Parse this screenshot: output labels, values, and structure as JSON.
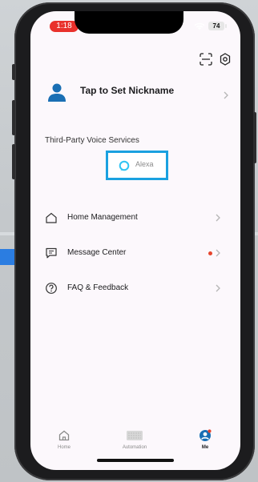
{
  "status_bar": {
    "time": "1:18",
    "battery": "74"
  },
  "profile": {
    "nickname_prompt": "Tap to Set Nickname"
  },
  "voice_services": {
    "title": "Third-Party Voice Services",
    "alexa_label": "Alexa"
  },
  "menu": [
    {
      "label": "Home Management",
      "icon": "house-icon"
    },
    {
      "label": "Message Center",
      "icon": "message-icon",
      "unread": true
    },
    {
      "label": "FAQ & Feedback",
      "icon": "question-icon"
    }
  ],
  "tabs": [
    {
      "label": "Home",
      "icon": "home-tab-icon"
    },
    {
      "label": "Automation",
      "icon": "automation-tab-icon"
    },
    {
      "label": "Me",
      "icon": "me-tab-icon",
      "active": true,
      "badge": true
    }
  ],
  "colors": {
    "accent_blue": "#1a6fb4",
    "highlight_border": "#1aa1e0",
    "alexa_cyan": "#31c4f3",
    "unread_dot": "#e6452d",
    "time_pill": "#e9312c"
  }
}
